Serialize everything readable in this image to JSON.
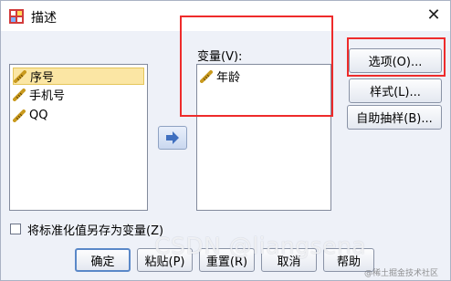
{
  "dialog": {
    "title": "描述",
    "close_glyph": "✕"
  },
  "source_list": {
    "items": [
      {
        "label": "序号",
        "icon": "ruler-icon",
        "selected": true
      },
      {
        "label": "手机号",
        "icon": "ruler-icon",
        "selected": false
      },
      {
        "label": "QQ",
        "icon": "ruler-icon",
        "selected": false
      }
    ]
  },
  "move_button": {
    "icon": "right-arrow-icon"
  },
  "variables": {
    "label": "变量(V):",
    "items": [
      {
        "label": "年龄",
        "icon": "ruler-icon"
      }
    ]
  },
  "side_buttons": {
    "options": "选项(O)...",
    "style": "样式(L)...",
    "bootstrap": "自助抽样(B)..."
  },
  "save_standardized": {
    "label": "将标准化值另存为变量(Z)",
    "checked": false
  },
  "bottom_buttons": {
    "ok": "确定",
    "paste": "粘贴(P)",
    "reset": "重置(R)",
    "cancel": "取消",
    "help": "帮助"
  },
  "watermarks": {
    "main": "CSDN @liangsena",
    "corner": "@稀土掘金技术社区"
  },
  "colors": {
    "selection_bg": "#fbe6a4",
    "highlight_border": "#ee2b2b",
    "move_arrow": "#3f6fbf"
  }
}
